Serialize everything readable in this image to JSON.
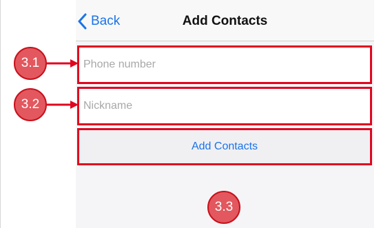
{
  "navbar": {
    "back_label": "Back",
    "title": "Add Contacts"
  },
  "form": {
    "phone_placeholder": "Phone number",
    "phone_value": "",
    "nickname_placeholder": "Nickname",
    "nickname_value": "",
    "submit_label": "Add Contacts"
  },
  "annotations": {
    "callout_1": "3.1",
    "callout_2": "3.2",
    "callout_3": "3.3"
  },
  "colors": {
    "accent": "#1a73e8",
    "highlight_border": "#e0061f",
    "callout_fill": "#e2585e"
  },
  "icons": {
    "back": "chevron-left-icon",
    "arrow": "arrow-right-icon"
  }
}
